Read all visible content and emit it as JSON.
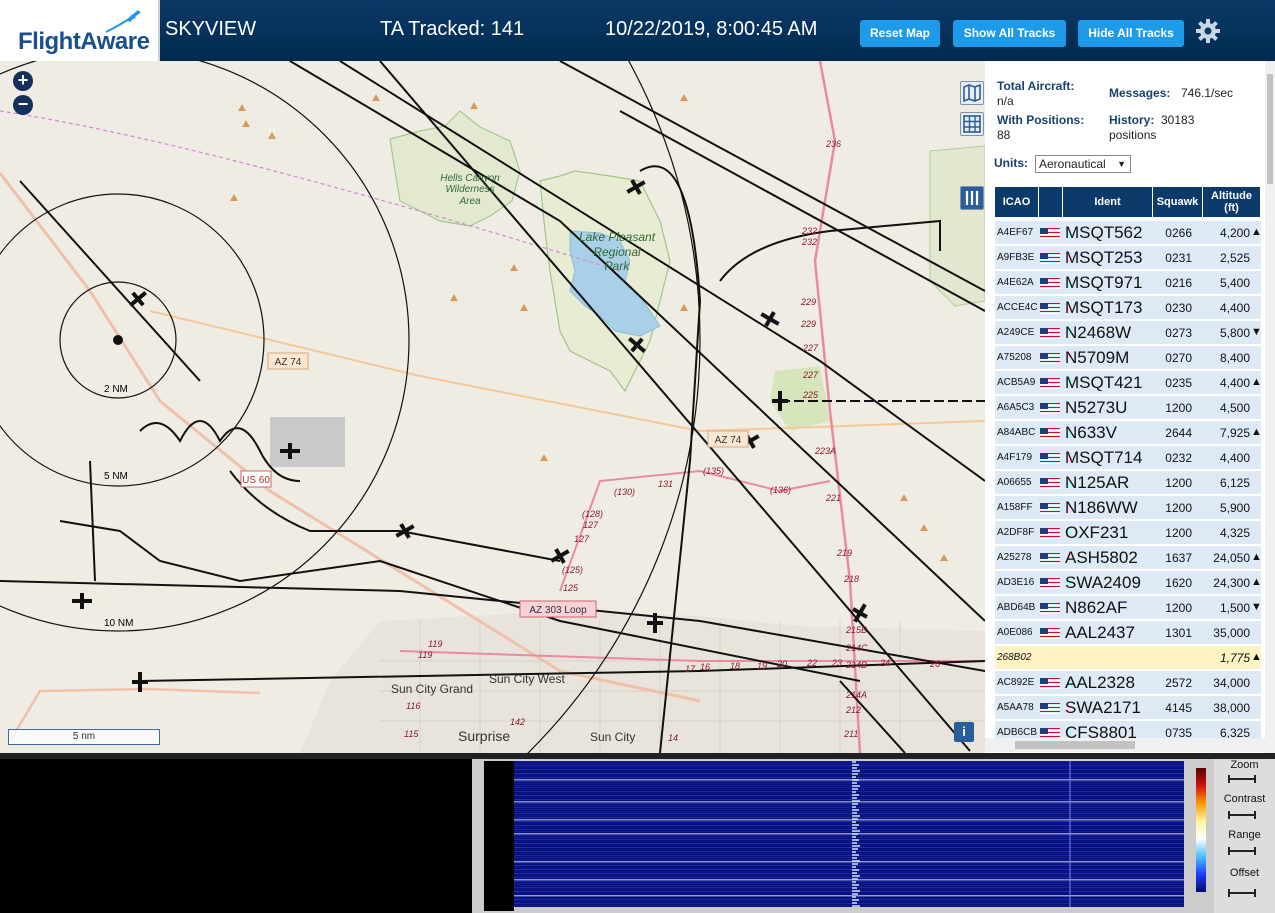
{
  "header": {
    "logo_text": "FlightAware",
    "app_title": "SKYVIEW",
    "tracked_label": "TA Tracked: 141",
    "datetime": "10/22/2019, 8:00:45 AM",
    "buttons": {
      "reset_map": "Reset Map",
      "show_all": "Show All Tracks",
      "hide_all": "Hide All Tracks"
    },
    "accent_color": "#1d9ae8"
  },
  "map": {
    "zoom_in": "+",
    "zoom_out": "−",
    "scale_label": "5 nm",
    "info_label": "i",
    "ring_labels": [
      "2 NM",
      "5 NM",
      "10 NM"
    ],
    "place_labels": {
      "hells_canyon": [
        "Hells Canyon",
        "Wilderness",
        "Area"
      ],
      "lake_pleasant": [
        "Lake Pleasant",
        "Regional",
        "Park"
      ],
      "sun_city_grand": "Sun City Grand",
      "sun_city_west": "Sun City West",
      "surprise": "Surprise",
      "sun_city": "Sun City"
    },
    "road_labels": {
      "az74_a": "AZ 74",
      "az74_b": "AZ 74",
      "us60": "US 60",
      "az303": "AZ 303 Loop"
    },
    "route_numbers": [
      "236",
      "232",
      "232",
      "229",
      "229",
      "227",
      "227",
      "225",
      "223A",
      "221",
      "219",
      "218",
      "215B",
      "214C",
      "214B",
      "214A",
      "212",
      "211",
      "(135)",
      "(136)",
      "(130)",
      "131",
      "(128)",
      "127",
      "127",
      "(125)",
      "125",
      "119",
      "119",
      "116",
      "115",
      "142",
      "14",
      "17",
      "16",
      "18",
      "19",
      "20",
      "22",
      "23",
      "24",
      "26"
    ]
  },
  "stats": {
    "total_aircraft_label": "Total Aircraft:",
    "total_aircraft_value": "n/a",
    "with_positions_label": "With Positions:",
    "with_positions_value": "88",
    "messages_label": "Messages:",
    "messages_value": "746.1/sec",
    "history_label": "History:",
    "history_value": "30183",
    "history_unit": "positions"
  },
  "units": {
    "label": "Units:",
    "selected": "Aeronautical"
  },
  "table": {
    "headers": {
      "icao": "ICAO",
      "ident": "Ident",
      "squawk": "Squawk",
      "altitude": "Altitude",
      "altitude_unit": "(ft)"
    },
    "rows": [
      {
        "icao": "A4EF67",
        "ident": "MSQT562",
        "squawk": "0266",
        "altitude": "4,200",
        "trend": "▲",
        "flag": true
      },
      {
        "icao": "A9FB3E",
        "ident": "MSQT253",
        "squawk": "0231",
        "altitude": "2,525",
        "trend": "",
        "flag": true
      },
      {
        "icao": "A4E62A",
        "ident": "MSQT971",
        "squawk": "0216",
        "altitude": "5,400",
        "trend": "",
        "flag": true
      },
      {
        "icao": "ACCE4C",
        "ident": "MSQT173",
        "squawk": "0230",
        "altitude": "4,400",
        "trend": "",
        "flag": true
      },
      {
        "icao": "A249CE",
        "ident": "N2468W",
        "squawk": "0273",
        "altitude": "5,800",
        "trend": "▼",
        "flag": true
      },
      {
        "icao": "A75208",
        "ident": "N5709M",
        "squawk": "0270",
        "altitude": "8,400",
        "trend": "",
        "flag": true
      },
      {
        "icao": "ACB5A9",
        "ident": "MSQT421",
        "squawk": "0235",
        "altitude": "4,400",
        "trend": "▲",
        "flag": true
      },
      {
        "icao": "A6A5C3",
        "ident": "N5273U",
        "squawk": "1200",
        "altitude": "4,500",
        "trend": "",
        "flag": true
      },
      {
        "icao": "A84ABC",
        "ident": "N633V",
        "squawk": "2644",
        "altitude": "7,925",
        "trend": "▲",
        "flag": true
      },
      {
        "icao": "A4F179",
        "ident": "MSQT714",
        "squawk": "0232",
        "altitude": "4,400",
        "trend": "",
        "flag": true
      },
      {
        "icao": "A06655",
        "ident": "N125AR",
        "squawk": "1200",
        "altitude": "6,125",
        "trend": "",
        "flag": true
      },
      {
        "icao": "A158FF",
        "ident": "N186WW",
        "squawk": "1200",
        "altitude": "5,900",
        "trend": "",
        "flag": true
      },
      {
        "icao": "A2DF8F",
        "ident": "OXF231",
        "squawk": "1200",
        "altitude": "4,325",
        "trend": "",
        "flag": true
      },
      {
        "icao": "A25278",
        "ident": "ASH5802",
        "squawk": "1637",
        "altitude": "24,050",
        "trend": "▲",
        "flag": true
      },
      {
        "icao": "AD3E16",
        "ident": "SWA2409",
        "squawk": "1620",
        "altitude": "24,300",
        "trend": "▲",
        "flag": true
      },
      {
        "icao": "ABD64B",
        "ident": "N862AF",
        "squawk": "1200",
        "altitude": "1,500",
        "trend": "▼",
        "flag": true
      },
      {
        "icao": "A0E086",
        "ident": "AAL2437",
        "squawk": "1301",
        "altitude": "35,000",
        "trend": "",
        "flag": true
      },
      {
        "icao": "268B02",
        "ident": "",
        "squawk": "",
        "altitude": "1,775",
        "trend": "▲",
        "flag": false,
        "highlight": true
      },
      {
        "icao": "AC892E",
        "ident": "AAL2328",
        "squawk": "2572",
        "altitude": "34,000",
        "trend": "",
        "flag": true
      },
      {
        "icao": "A5AA78",
        "ident": "SWA2171",
        "squawk": "4145",
        "altitude": "38,000",
        "trend": "",
        "flag": true
      },
      {
        "icao": "ADB6CB",
        "ident": "CFS8801",
        "squawk": "0735",
        "altitude": "6,325",
        "trend": "",
        "flag": true
      }
    ]
  },
  "waterfall": {
    "controls": {
      "zoom": "Zoom",
      "contrast": "Contrast",
      "range": "Range",
      "offset": "Offset"
    }
  }
}
